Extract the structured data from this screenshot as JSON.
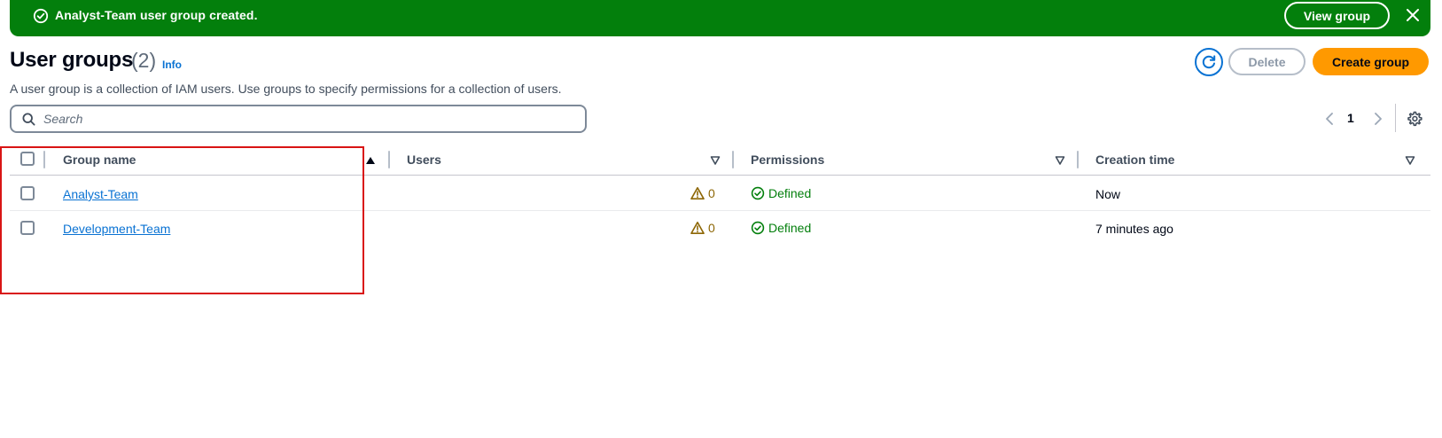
{
  "flash": {
    "message": "Analyst-Team user group created.",
    "view_label": "View group",
    "color": "#037f0c"
  },
  "header": {
    "title": "User groups",
    "count": "(2)",
    "info": "Info",
    "description": "A user group is a collection of IAM users. Use groups to specify permissions for a collection of users."
  },
  "actions": {
    "delete_label": "Delete",
    "create_label": "Create group",
    "accent": "#ff9900"
  },
  "search": {
    "placeholder": "Search",
    "value": ""
  },
  "pagination": {
    "current_page": "1"
  },
  "table": {
    "columns": [
      "Group name",
      "Users",
      "Permissions",
      "Creation time"
    ],
    "rows": [
      {
        "name": "Analyst-Team",
        "users": "0",
        "permissions": "Defined",
        "created": "Now"
      },
      {
        "name": "Development-Team",
        "users": "0",
        "permissions": "Defined",
        "created": "7 minutes ago"
      }
    ]
  },
  "icons": {
    "flash": "success-circle-icon",
    "close": "close-icon",
    "refresh": "refresh-icon",
    "search": "search-icon",
    "prev": "chevron-left-icon",
    "next": "chevron-right-icon",
    "settings": "gear-icon",
    "sort": "sort-icon",
    "warning": "warning-icon",
    "defined": "check-circle-icon"
  }
}
